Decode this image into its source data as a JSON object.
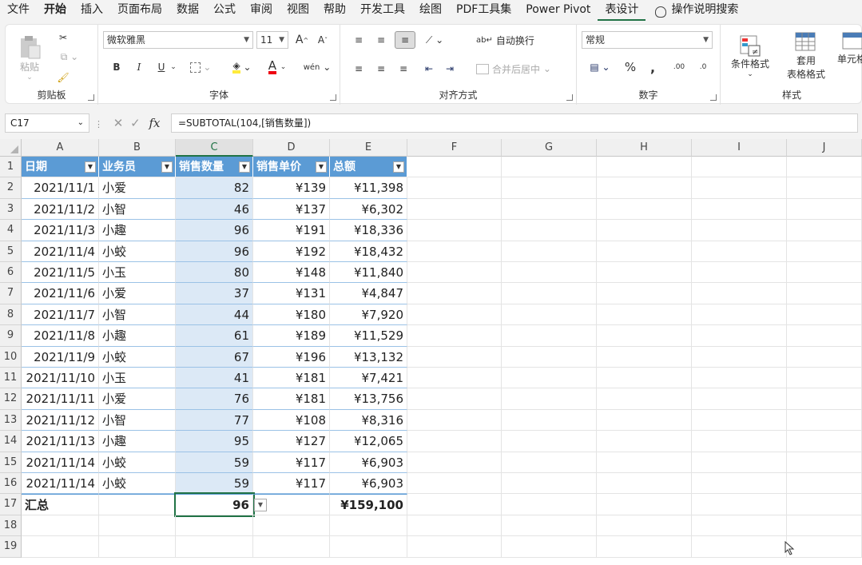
{
  "menu": [
    "文件",
    "开始",
    "插入",
    "页面布局",
    "数据",
    "公式",
    "审阅",
    "视图",
    "帮助",
    "开发工具",
    "绘图",
    "PDF工具集",
    "Power Pivot",
    "表设计"
  ],
  "tellme": "操作说明搜索",
  "ribbon": {
    "clipboard": {
      "paste": "粘贴",
      "label": "剪贴板"
    },
    "font": {
      "name": "微软雅黑",
      "size": "11",
      "grow": "A",
      "shrink": "A",
      "bold": "B",
      "italic": "I",
      "underline": "U",
      "fontcolor_glyph": "A",
      "phonetic": "wén",
      "label": "字体"
    },
    "align": {
      "wrap": "自动换行",
      "merge": "合并后居中",
      "label": "对齐方式"
    },
    "number": {
      "format": "常规",
      "percent": "%",
      "comma": ",",
      "inc": ".00",
      "dec": ".0",
      "label": "数字"
    },
    "styles": {
      "cond": "条件格式",
      "table1": "套用",
      "table2": "表格格式",
      "cell": "单元格",
      "label": "样式"
    }
  },
  "formula_bar": {
    "namebox": "C17",
    "fx": "fx",
    "formula": "=SUBTOTAL(104,[销售数量])"
  },
  "columns": [
    "A",
    "B",
    "C",
    "D",
    "E",
    "F",
    "G",
    "H",
    "I",
    "J"
  ],
  "table": {
    "headers": [
      "日期",
      "业务员",
      "销售数量",
      "销售单价",
      "总额"
    ],
    "rows": [
      [
        "2021/11/1",
        "小爱",
        "82",
        "¥139",
        "¥11,398"
      ],
      [
        "2021/11/2",
        "小智",
        "46",
        "¥137",
        "¥6,302"
      ],
      [
        "2021/11/3",
        "小趣",
        "96",
        "¥191",
        "¥18,336"
      ],
      [
        "2021/11/4",
        "小蛟",
        "96",
        "¥192",
        "¥18,432"
      ],
      [
        "2021/11/5",
        "小玉",
        "80",
        "¥148",
        "¥11,840"
      ],
      [
        "2021/11/6",
        "小爱",
        "37",
        "¥131",
        "¥4,847"
      ],
      [
        "2021/11/7",
        "小智",
        "44",
        "¥180",
        "¥7,920"
      ],
      [
        "2021/11/8",
        "小趣",
        "61",
        "¥189",
        "¥11,529"
      ],
      [
        "2021/11/9",
        "小蛟",
        "67",
        "¥196",
        "¥13,132"
      ],
      [
        "2021/11/10",
        "小玉",
        "41",
        "¥181",
        "¥7,421"
      ],
      [
        "2021/11/11",
        "小爱",
        "76",
        "¥181",
        "¥13,756"
      ],
      [
        "2021/11/12",
        "小智",
        "77",
        "¥108",
        "¥8,316"
      ],
      [
        "2021/11/13",
        "小趣",
        "95",
        "¥127",
        "¥12,065"
      ],
      [
        "2021/11/14",
        "小蛟",
        "59",
        "¥117",
        "¥6,903"
      ],
      [
        "2021/11/14",
        "小蛟",
        "59",
        "¥117",
        "¥6,903"
      ]
    ],
    "total": {
      "label": "汇总",
      "qty": "96",
      "amount": "¥159,100"
    }
  },
  "row_numbers": [
    "1",
    "2",
    "3",
    "4",
    "5",
    "6",
    "7",
    "8",
    "9",
    "10",
    "11",
    "12",
    "13",
    "14",
    "15",
    "16",
    "17",
    "18",
    "19"
  ],
  "colors": {
    "header_fill": "#5b9bd5",
    "selected_col": "#dce9f6",
    "accent": "#217346"
  }
}
